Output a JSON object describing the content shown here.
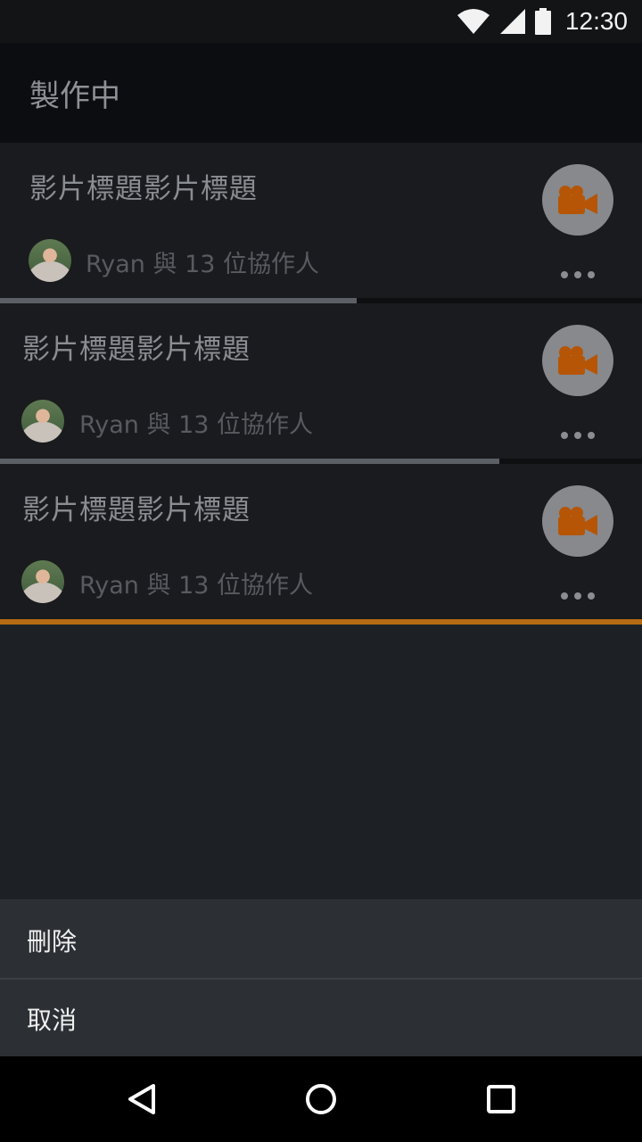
{
  "status_bar": {
    "time": "12:30",
    "icons": [
      "wifi-icon",
      "signal-icon",
      "battery-icon"
    ]
  },
  "app_bar": {
    "title": "製作中"
  },
  "cards": [
    {
      "title": "影片標題影片標題",
      "subtitle": "Ryan 與 13 位協作人",
      "progress": 0.555,
      "progress_color": "#5c6066"
    },
    {
      "title": "影片標題影片標題",
      "subtitle": "Ryan 與 13 位協作人",
      "progress": 0.778,
      "progress_color": "#5c6066"
    },
    {
      "title": "影片標題影片標題",
      "subtitle": "Ryan 與 13 位協作人",
      "progress": 1.0,
      "progress_color": "#b66a13"
    }
  ],
  "sheet": {
    "delete_label": "刪除",
    "cancel_label": "取消"
  },
  "colors": {
    "accent": "#b65505",
    "sheet_bg": "#2c3035"
  }
}
